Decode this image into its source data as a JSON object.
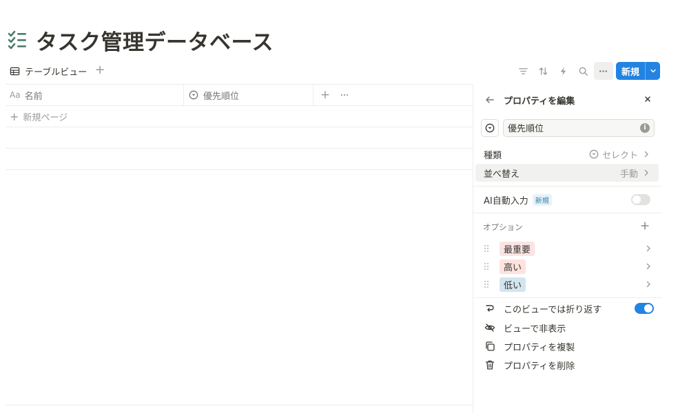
{
  "page": {
    "title": "タスク管理データベース",
    "icon": "checklist-icon"
  },
  "view": {
    "tab_label": "テーブルビュー",
    "tab_icon": "table-icon",
    "add_view_icon": "plus-icon"
  },
  "toolbar": {
    "icons": [
      "filter-icon",
      "sort-icon",
      "automation-bolt-icon",
      "search-icon",
      "more-icon"
    ],
    "new_label": "新規"
  },
  "table": {
    "columns": [
      {
        "icon_text": "Aa",
        "label": "名前"
      },
      {
        "icon": "select-icon",
        "label": "優先順位"
      }
    ],
    "new_page_label": "新規ページ"
  },
  "panel": {
    "title": "プロパティを編集",
    "property_name": "優先順位",
    "type_label": "種類",
    "type_value": "セレクト",
    "sort_label": "並べ替え",
    "sort_value": "手動",
    "ai_label": "AI自動入力",
    "ai_badge": "新規",
    "ai_enabled": false,
    "options_label": "オプション",
    "options": [
      {
        "label": "最重要",
        "color": "#fbe4e4"
      },
      {
        "label": "高い",
        "color": "#fde2dd"
      },
      {
        "label": "低い",
        "color": "#d3e5ef"
      }
    ],
    "actions": [
      {
        "icon": "wrap-icon",
        "label": "このビューでは折り返す",
        "toggle": true
      },
      {
        "icon": "eye-off-icon",
        "label": "ビューで非表示"
      },
      {
        "icon": "duplicate-icon",
        "label": "プロパティを複製"
      },
      {
        "icon": "trash-icon",
        "label": "プロパティを削除"
      }
    ]
  },
  "colors": {
    "accent": "#2383e2",
    "title_icon": "#4a7c6b",
    "text": "#37352f",
    "muted": "#9b9a97"
  }
}
